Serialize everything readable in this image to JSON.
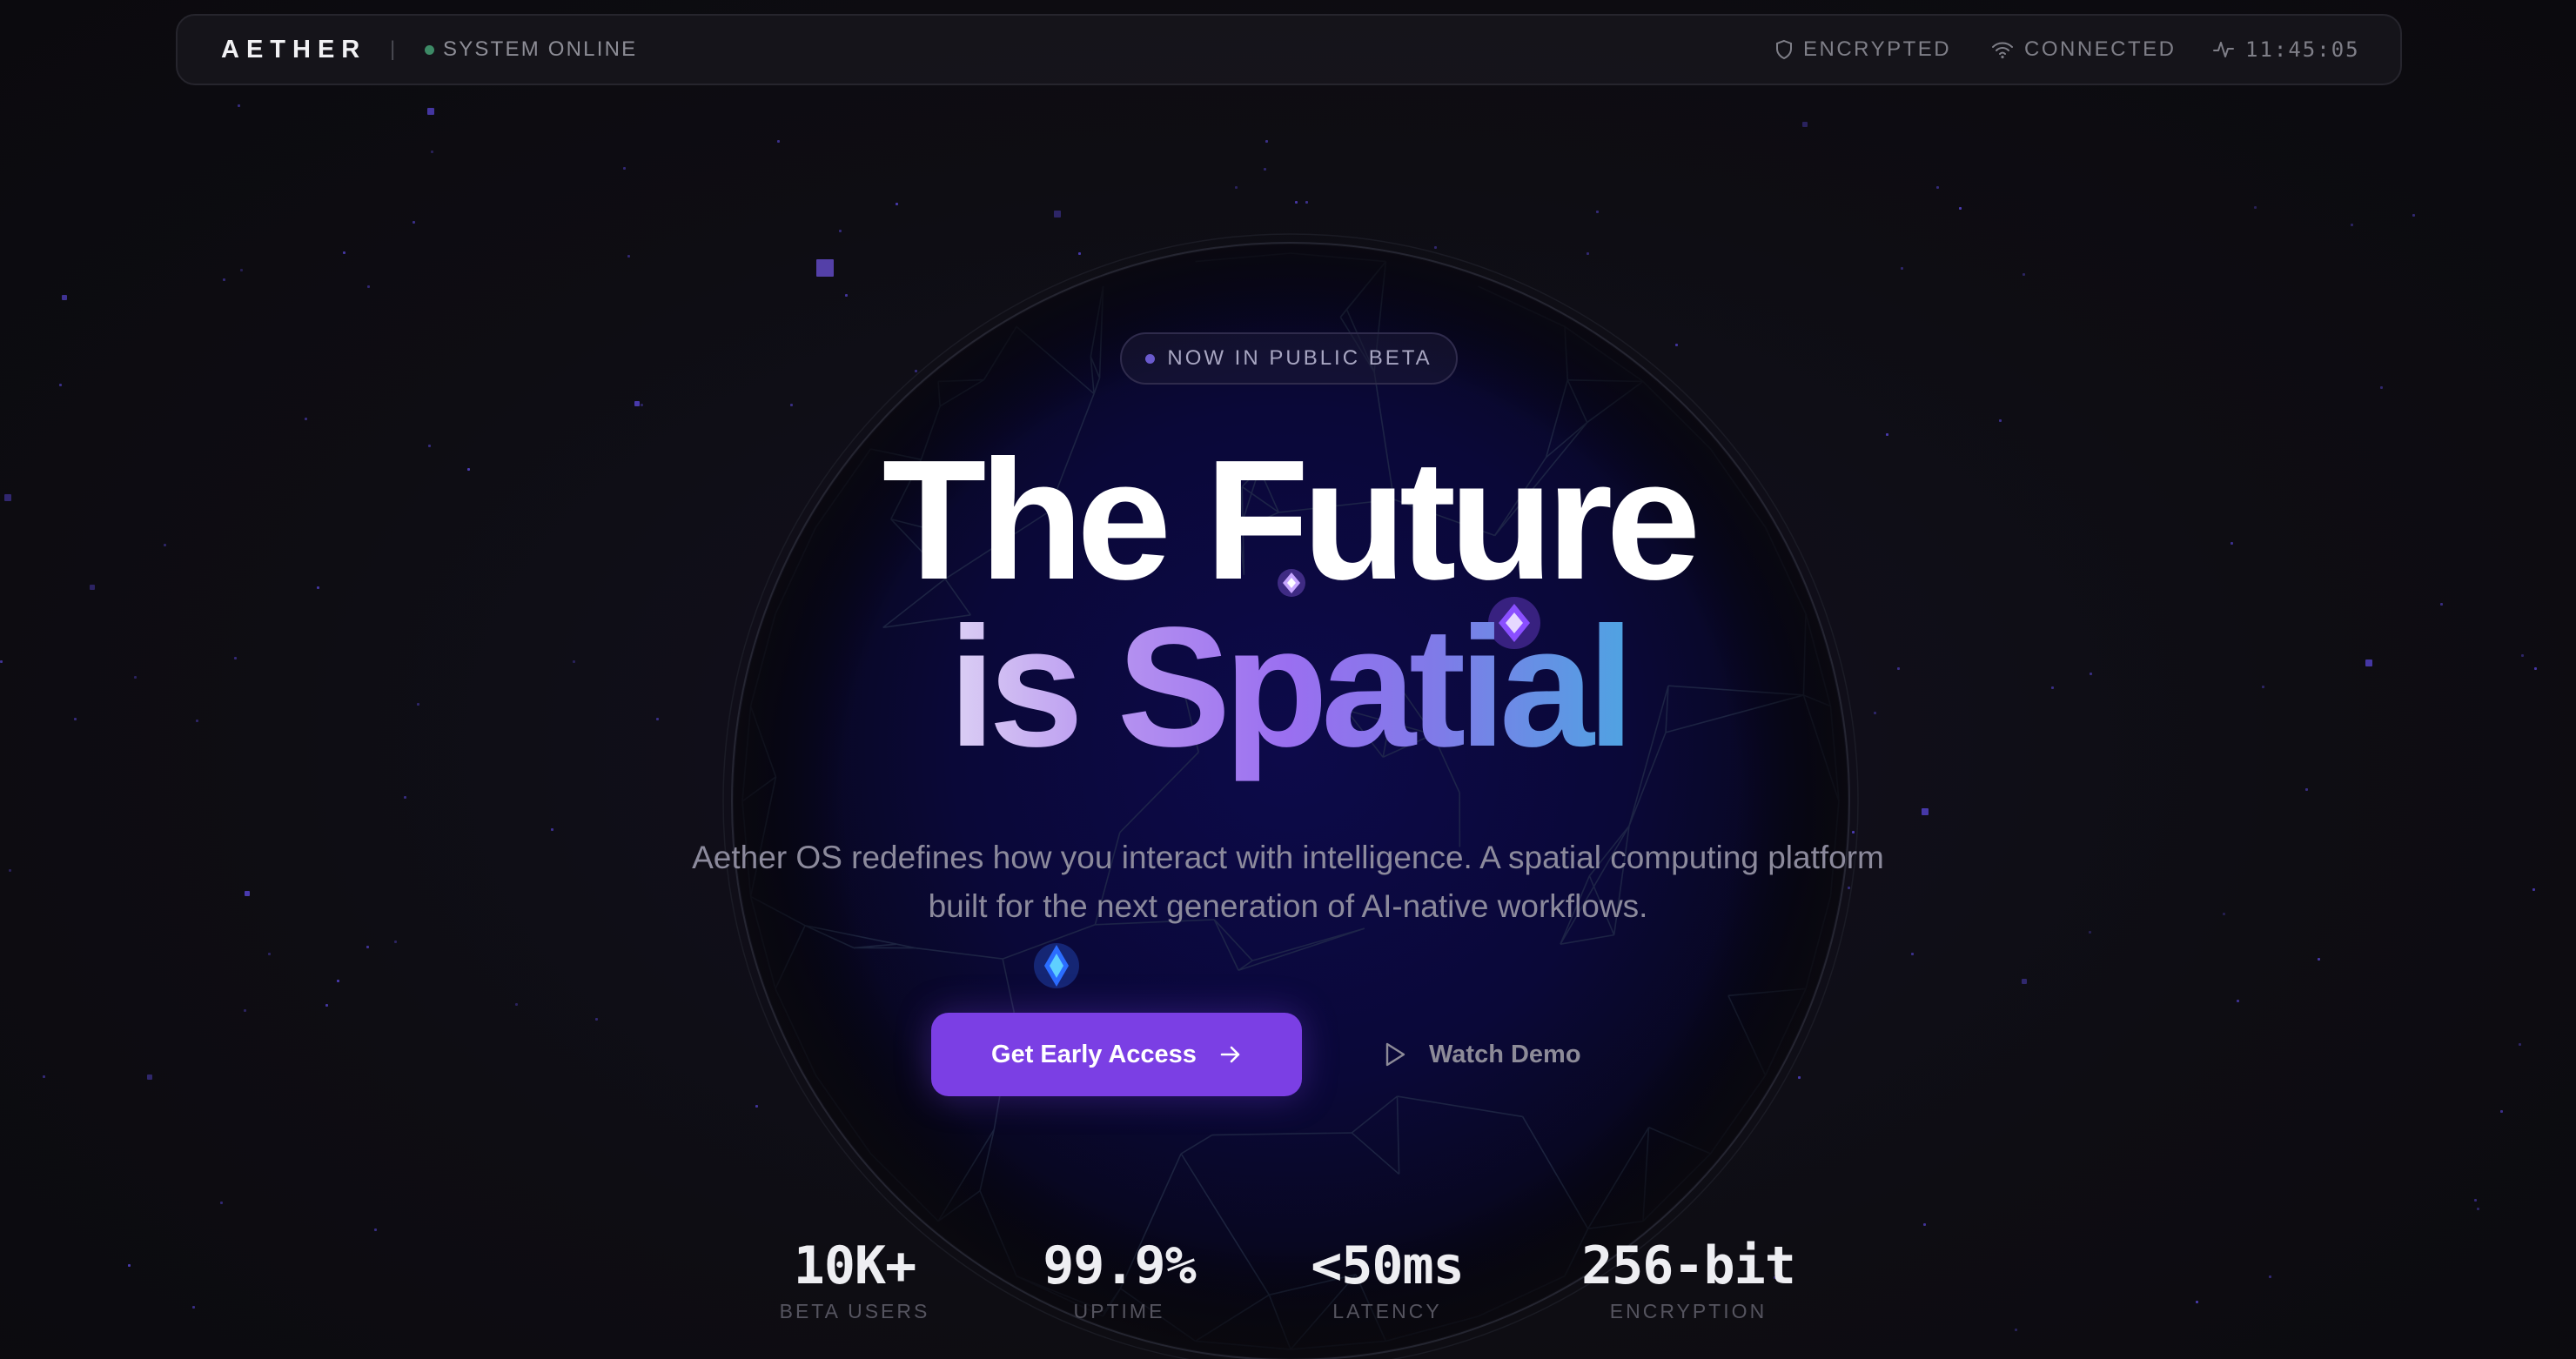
{
  "topbar": {
    "logo": "AETHER",
    "divider": "|",
    "system_status": "SYSTEM ONLINE",
    "encrypted_label": "ENCRYPTED",
    "connected_label": "CONNECTED",
    "clock": "11:45:05"
  },
  "hero": {
    "badge": "NOW IN PUBLIC BETA",
    "headline_line1": "The Future",
    "headline_line2": "is Spatial",
    "subtitle": "Aether OS redefines how you interact with intelligence. A spatial computing platform built for the next generation of AI-native workflows.",
    "cta_primary": "Get Early Access",
    "cta_secondary": "Watch Demo"
  },
  "stats": [
    {
      "value": "10K+",
      "label": "BETA USERS"
    },
    {
      "value": "99.9%",
      "label": "UPTIME"
    },
    {
      "value": "<50ms",
      "label": "LATENCY"
    },
    {
      "value": "256-bit",
      "label": "ENCRYPTION"
    }
  ],
  "icons": {
    "status_dot": "status-dot-icon",
    "encrypted": "shield-icon",
    "connected": "wifi-icon",
    "clock": "activity-icon",
    "badge_dot": "badge-dot-icon",
    "cta_arrow": "arrow-right-icon",
    "demo_play": "play-icon"
  },
  "colors": {
    "accent": "#7b3fe4",
    "background": "#0d0c10",
    "status_online": "#3d8a66",
    "gradient_start": "#dcd0f4",
    "gradient_end": "#4fa3e2"
  }
}
